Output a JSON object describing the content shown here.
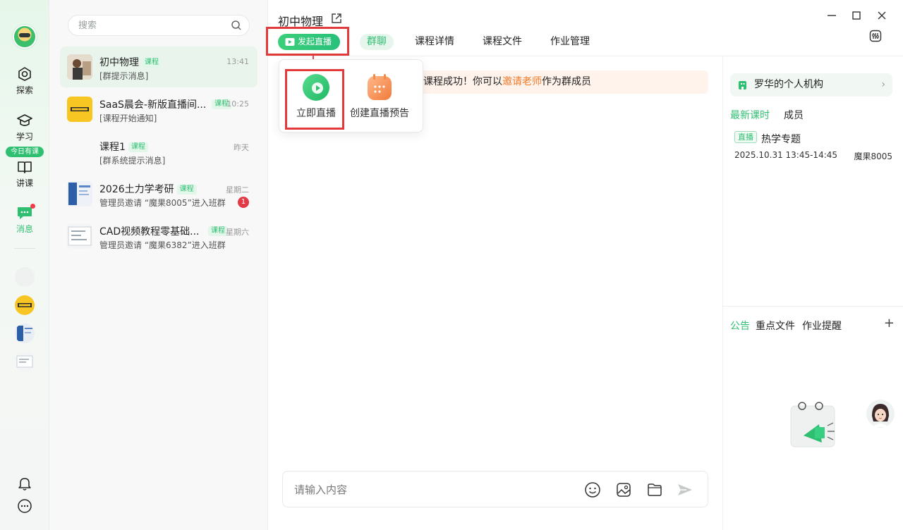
{
  "rail": {
    "items": [
      {
        "label": "探索"
      },
      {
        "label": "学习"
      },
      {
        "label": "讲课"
      },
      {
        "label": "消息"
      }
    ],
    "today_badge": "今日有课"
  },
  "search": {
    "placeholder": "搜索"
  },
  "conversations": [
    {
      "name": "初中物理",
      "tag": "课程",
      "time": "13:41",
      "sub": "[群提示消息]"
    },
    {
      "name": "SaaS晨会-新版直播间...",
      "tag": "课程",
      "time": "10:25",
      "sub": "[课程开始通知]"
    },
    {
      "name": "课程1",
      "tag": "课程",
      "time": "昨天",
      "sub": "[群系统提示消息]"
    },
    {
      "name": "2026土力学考研",
      "tag": "课程",
      "time": "星期二",
      "sub": "管理员邀请 “魔果8005”进入班群",
      "unread": "1"
    },
    {
      "name": "CAD视频教程零基础...",
      "tag": "课程",
      "time": "星期六",
      "sub": "管理员邀请 “魔果6382”进入班群"
    }
  ],
  "header": {
    "title": "初中物理",
    "live_button": "发起直播",
    "tabs": [
      "群聊",
      "课程详情",
      "课程文件",
      "作业管理"
    ]
  },
  "notice": {
    "before": "课程成功！你可以",
    "link": "邀请老师",
    "after": "作为群成员"
  },
  "popup": {
    "live_now": "立即直播",
    "schedule": "创建直播预告"
  },
  "right": {
    "org": "罗华的个人机构",
    "tabs": [
      "最新课时",
      "成员"
    ],
    "lesson": {
      "tag": "直播",
      "title": "热学专题",
      "time": "2025.10.31 13:45-14:45",
      "who": "魔果8005"
    },
    "bottom_tabs": [
      "公告",
      "重点文件",
      "作业提醒"
    ],
    "plus": "+"
  },
  "composer": {
    "placeholder": "请输入内容"
  },
  "colors": {
    "accent": "#2fbf71",
    "highlight_box": "#e23a3a",
    "notice_link": "#f07a2a"
  }
}
